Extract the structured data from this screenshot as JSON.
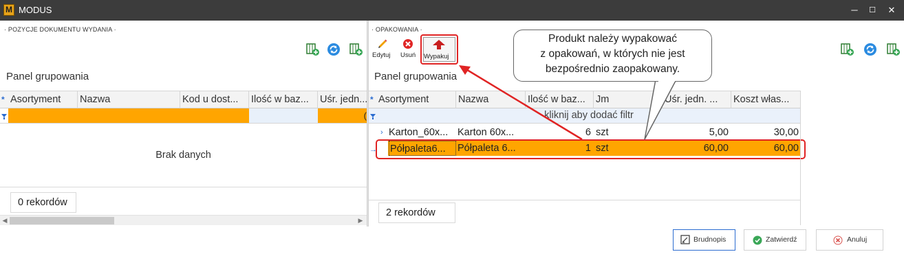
{
  "window": {
    "title": "MODUS",
    "logo_letter": "M",
    "logo_sub": "MODUS",
    "minimize_symbol": "─",
    "maximize_symbol": "☐",
    "close_symbol": "✕"
  },
  "left_panel": {
    "section_title": "· POZYCJE DOKUMENTU WYDANIA ·",
    "group_panel_label": "Panel grupowania",
    "columns": [
      "Asortyment",
      "Nazwa",
      "Kod u dost...",
      "Ilość w baz...",
      "Uśr. jedn..."
    ],
    "empty_message": "Brak danych",
    "record_count": "0 rekordów",
    "filter_cell_tail": "("
  },
  "right_panel": {
    "section_title": "· OPAKOWANIA ·",
    "toolbar": {
      "edit_label": "Edytuj",
      "delete_label": "Usuń",
      "unpack_label": "Wypakuj"
    },
    "group_panel_label": "Panel grupowania",
    "columns": [
      "Asortyment",
      "Nazwa",
      "Ilość w baz...",
      "Jm",
      "Uśr. jedn. ...",
      "Koszt włas..."
    ],
    "filter_hint": "kliknij aby dodać filtr",
    "rows": [
      {
        "asortyment": "Karton_60x...",
        "nazwa": "Karton 60x...",
        "ilosc": "6",
        "jm": "szt",
        "usr": "5,00",
        "koszt": "30,00",
        "selected": false
      },
      {
        "asortyment": "Półpaleta6...",
        "nazwa": "Półpaleta 6...",
        "ilosc": "1",
        "jm": "szt",
        "usr": "60,00",
        "koszt": "60,00",
        "selected": true
      }
    ],
    "record_count": "2 rekordów"
  },
  "callout": {
    "lines": [
      "Produkt należy wypakować",
      "z opakowań, w których nie jest",
      "bezpośrednio zaopakowany."
    ]
  },
  "buttons": {
    "draft": "Brudnopis",
    "confirm": "Zatwierdź",
    "cancel": "Anuluj"
  },
  "colors": {
    "titlebar": "#3c3c3c",
    "selection": "#ffa500",
    "highlight_red": "#e02424",
    "accent_blue": "#2b6cd0",
    "confirm_green": "#3aa757"
  }
}
